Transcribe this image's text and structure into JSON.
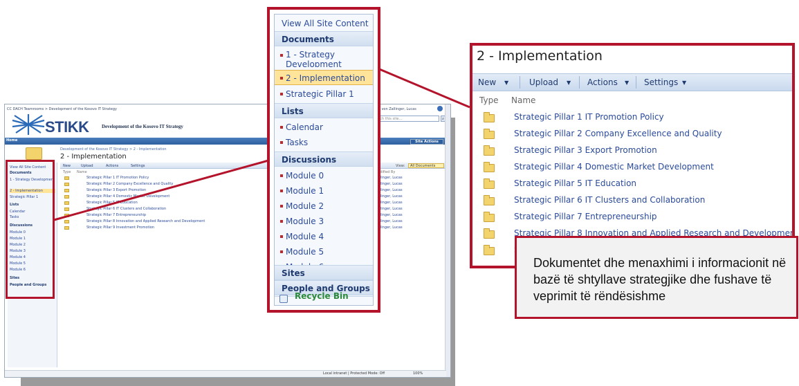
{
  "background_screenshot": {
    "breadcrumb": "CC DACH Teamrooms > Development of the Kosovo IT Strategy",
    "welcome": "Welcome von Zallinger, Lucas",
    "logo_text": "STIKK",
    "site_title": "Development of the Kosovo IT Strategy",
    "search_placeholder": "Search this site...",
    "home_tab": "Home",
    "site_actions": "Site Actions",
    "page_breadcrumb": "Development of the Kosovo IT Strategy > 2 - Implementation",
    "page_title": "2 - Implementation",
    "toolbar": [
      "New",
      "Upload",
      "Actions",
      "Settings"
    ],
    "view_label": "View:",
    "view_value": "All Documents",
    "columns": [
      "Type",
      "Name",
      "Modified By"
    ],
    "nav": {
      "view_all": "View All Site Content",
      "documents": "Documents",
      "doc_items": [
        "1 - Strategy Development",
        "2 - Implementation",
        "Strategic Pillar 1"
      ],
      "lists": "Lists",
      "list_items": [
        "Calendar",
        "Tasks"
      ],
      "discussions": "Discussions",
      "discussion_items": [
        "Module 0",
        "Module 1",
        "Module 2",
        "Module 3",
        "Module 4",
        "Module 5",
        "Module 6"
      ],
      "sites": "Sites",
      "people": "People and Groups"
    },
    "rows": [
      "Strategic Pillar 1 IT Promotion Policy",
      "Strategic Pillar 2 Company Excellence and Quality",
      "Strategic Pillar 3 Export Promotion",
      "Strategic Pillar 4 Domestic Market Development",
      "Strategic Pillar 5 IT Education",
      "Strategic Pillar 6 IT Clusters and Collaboration",
      "Strategic Pillar 7 Entrepreneurship",
      "Strategic Pillar 8 Innovation and Applied Research and Development",
      "Strategic Pillar 9 Investment Promotion"
    ],
    "modified_by": "Zallinger, Lucas",
    "status": "Local intranet | Protected Mode: Off",
    "zoom": "100%"
  },
  "nav_panel": {
    "view_all": "View All Site Content",
    "documents_heading": "Documents",
    "documents": [
      "1 - Strategy Development",
      "2 - Implementation",
      "Strategic Pillar 1"
    ],
    "lists_heading": "Lists",
    "lists": [
      "Calendar",
      "Tasks"
    ],
    "discussions_heading": "Discussions",
    "discussions": [
      "Module 0",
      "Module 1",
      "Module 2",
      "Module 3",
      "Module 4",
      "Module 5",
      "Module 6"
    ],
    "sites_heading": "Sites",
    "people_heading": "People and Groups",
    "recycle_bin": "Recycle Bin"
  },
  "library_panel": {
    "title": "2 - Implementation",
    "toolbar": {
      "new": "New",
      "upload": "Upload",
      "actions": "Actions",
      "settings": "Settings"
    },
    "columns": {
      "type": "Type",
      "name": "Name"
    },
    "rows": [
      "Strategic Pillar 1 IT Promotion Policy",
      "Strategic Pillar 2 Company Excellence and Quality",
      "Strategic Pillar 3 Export Promotion",
      "Strategic Pillar 4 Domestic Market Development",
      "Strategic Pillar 5 IT Education",
      "Strategic Pillar 6 IT Clusters and Collaboration",
      "Strategic Pillar 7 Entrepreneurship",
      "Strategic Pillar 8 Innovation and Applied Research and Development",
      "S"
    ]
  },
  "callout": {
    "text": "Dokumentet dhe menaxhimi i informacionit në bazë të shtyllave strategjike dhe fushave të veprimit të rëndësishme"
  },
  "colors": {
    "highlight_red": "#b3132b",
    "link_blue": "#2a4a9a",
    "heading_navy": "#1f3a6f",
    "selected_yellow": "#ffe49a"
  }
}
